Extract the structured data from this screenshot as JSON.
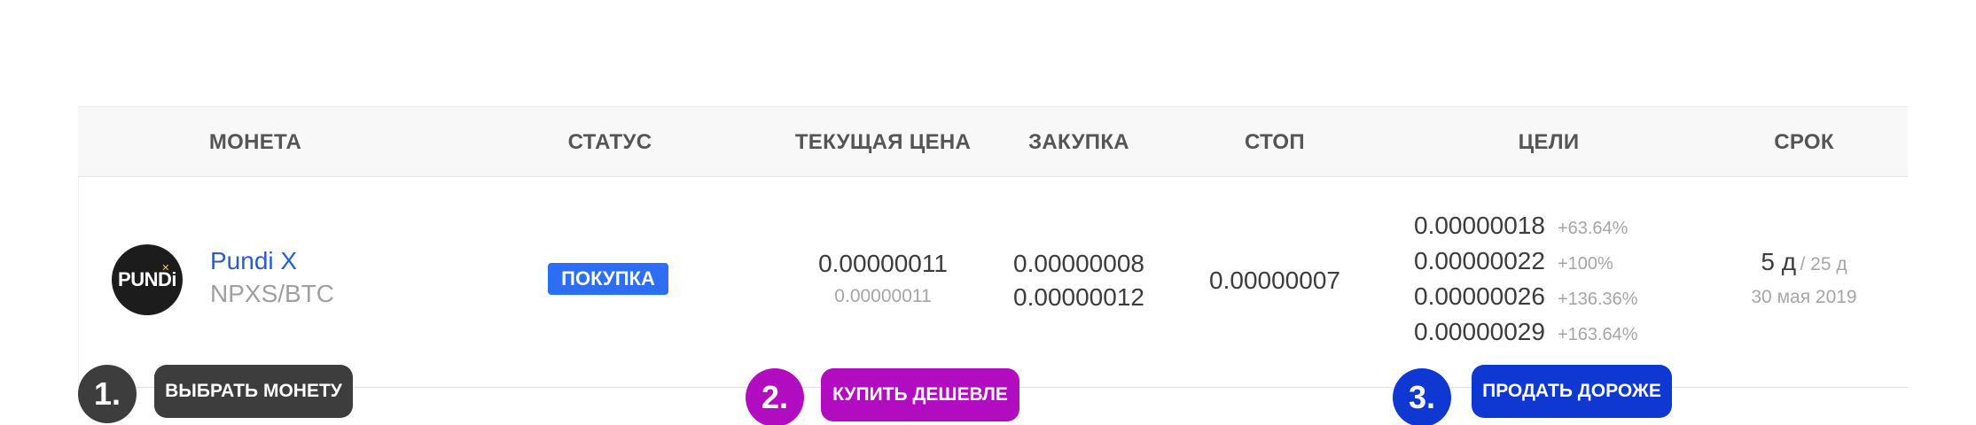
{
  "columns": {
    "coin": "МОНЕТА",
    "status": "СТАТУС",
    "current_price": "ТЕКУЩАЯ ЦЕНА",
    "purchase": "ЗАКУПКА",
    "stop": "СТОП",
    "targets": "ЦЕЛИ",
    "term": "СРОК"
  },
  "row": {
    "logo_text": "PUNDi",
    "logo_icon": "pundi-x-logo-icon",
    "coin_name": "Pundi X",
    "coin_pair": "NPXS/BTC",
    "status": "ПОКУПКА",
    "current_price": "0.00000011",
    "current_price_sub": "0.00000011",
    "purchase": [
      "0.00000008",
      "0.00000012"
    ],
    "stop": "0.00000007",
    "targets": [
      {
        "value": "0.00000018",
        "pct": "+63.64%"
      },
      {
        "value": "0.00000022",
        "pct": "+100%"
      },
      {
        "value": "0.00000026",
        "pct": "+136.36%"
      },
      {
        "value": "0.00000029",
        "pct": "+163.64%"
      }
    ],
    "term_main": "5 д",
    "term_total": "/ 25 д",
    "term_date": "30 мая 2019"
  },
  "steps": [
    {
      "number": "1.",
      "label": "ВЫБРАТЬ МОНЕТУ",
      "color": "#3d3d3d"
    },
    {
      "number": "2.",
      "label": "КУПИТЬ ДЕШЕВЛЕ",
      "color": "#b10cc0"
    },
    {
      "number": "3.",
      "label": "ПРОДАТЬ ДОРОЖЕ",
      "color": "#0f37d2"
    }
  ],
  "colors": {
    "coin_link": "#2a5bd7",
    "status_badge": "#2d6ef5",
    "header_bg": "#f8f8f8"
  }
}
